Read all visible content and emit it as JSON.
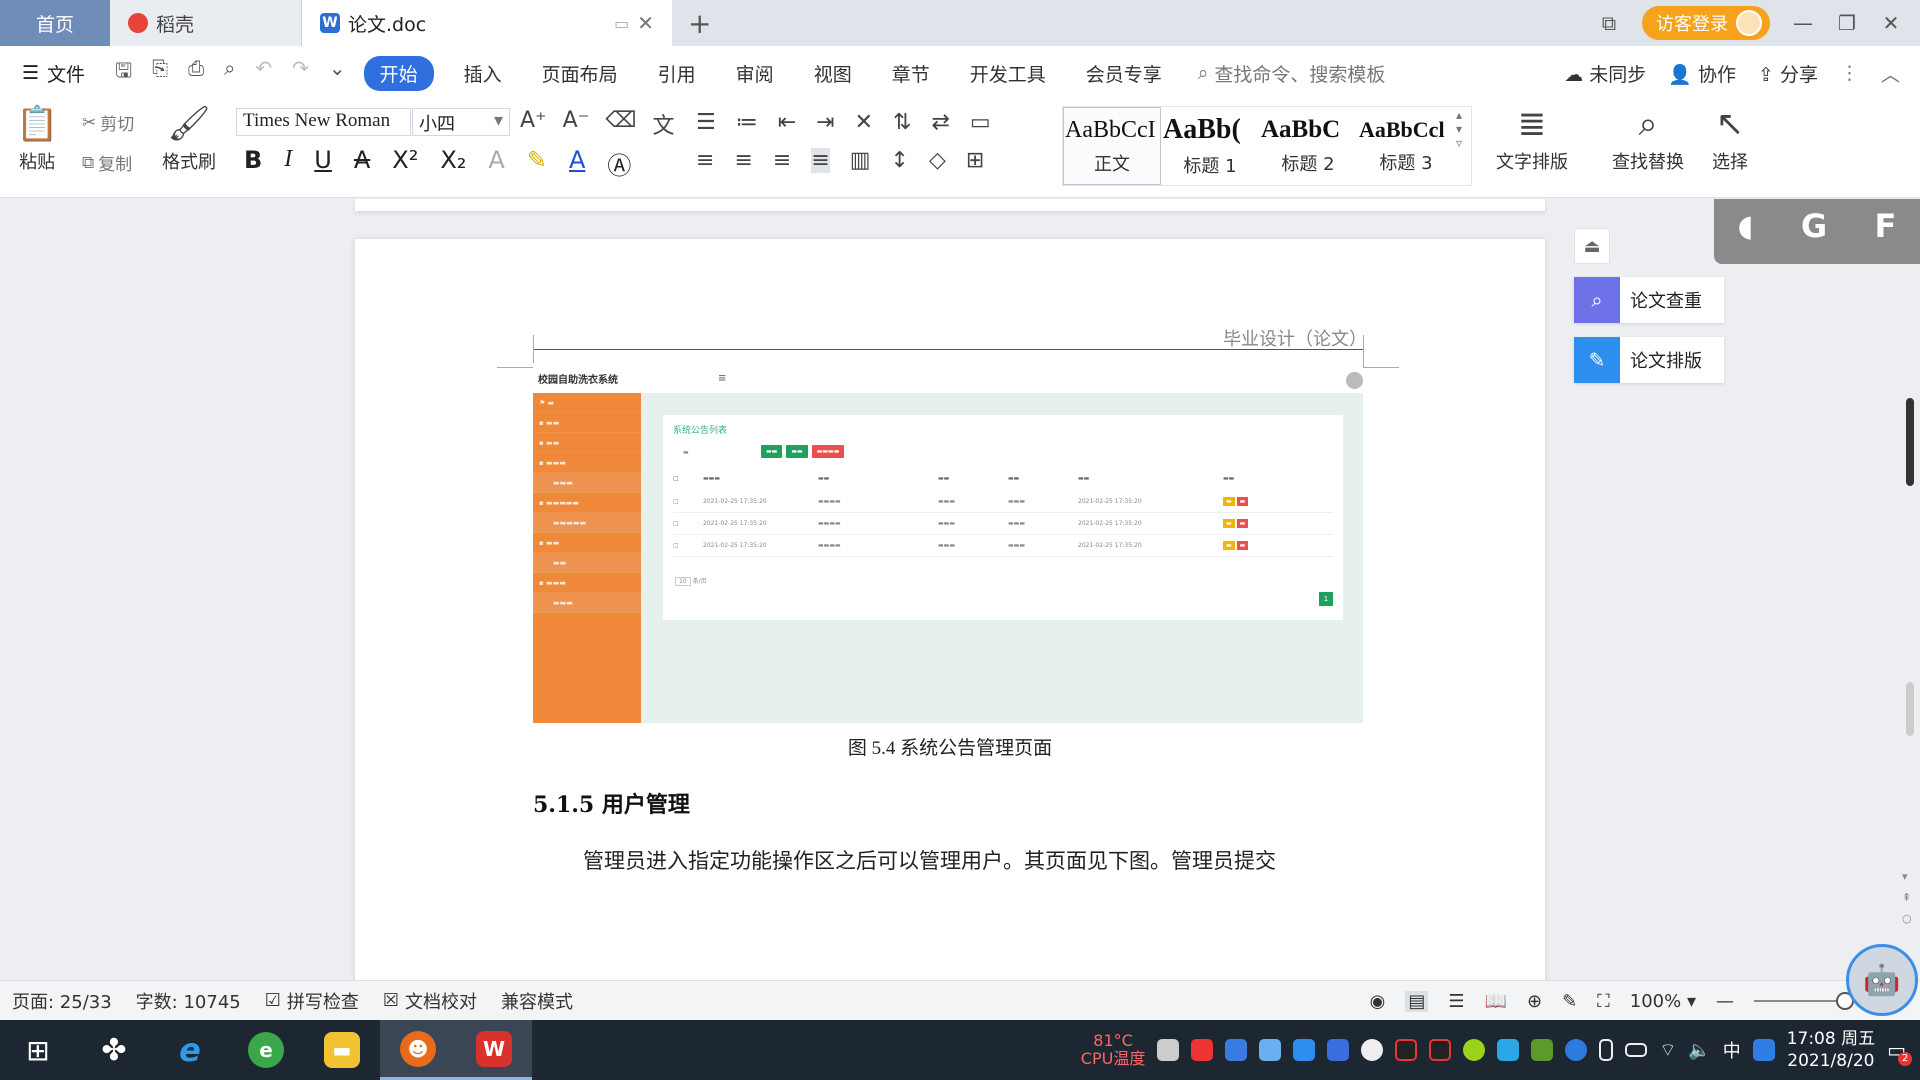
{
  "tabs": {
    "home": "首页",
    "daoke": "稻壳",
    "doc": "论文.doc",
    "visitor_login": "访客登录"
  },
  "menu": {
    "file": "文件",
    "items": [
      "开始",
      "插入",
      "页面布局",
      "引用",
      "审阅",
      "视图",
      "章节",
      "开发工具",
      "会员专享"
    ],
    "search_placeholder": "查找命令、搜索模板",
    "unsynced": "未同步",
    "collab": "协作",
    "share": "分享"
  },
  "ribbon": {
    "paste": "粘贴",
    "cut": "剪切",
    "copy": "复制",
    "format_painter": "格式刷",
    "font_name": "Times New Roman",
    "font_size": "小四",
    "styles": [
      {
        "sample": "AaBbCcI",
        "name": "正文"
      },
      {
        "sample": "AaBb(",
        "name": "标题 1"
      },
      {
        "sample": "AaBbC",
        "name": "标题 2"
      },
      {
        "sample": "AaBbCcl",
        "name": "标题 3"
      }
    ],
    "text_layout": "文字排版",
    "find_replace": "查找替换",
    "select": "选择"
  },
  "document": {
    "header_text": "毕业设计（论文）",
    "figure_caption": "图 5.4  系统公告管理页面",
    "section_heading": "5.1.5  用户管理",
    "body_text": "管理员进入指定功能操作区之后可以管理用户。其页面见下图。管理员提交"
  },
  "embedded_screenshot": {
    "app_title": "校园自助洗衣系统",
    "card_title": "系统公告列表",
    "rows": [
      {
        "time": "2021-02-25 17:35:20",
        "date": "2021-02-25 17:35:20"
      },
      {
        "time": "2021-02-25 17:35:20",
        "date": "2021-02-25 17:35:20"
      },
      {
        "time": "2021-02-25 17:35:20",
        "date": "2021-02-25 17:35:20"
      }
    ],
    "page_num": "1",
    "pager": "10",
    "pager_suffix": "条/页"
  },
  "side_panel": {
    "check": "论文查重",
    "format": "论文排版"
  },
  "ime": {
    "g": "G",
    "f": "F"
  },
  "status": {
    "page": "页面: 25/33",
    "words": "字数: 10745",
    "spell": "拼写检查",
    "proof": "文档校对",
    "compat": "兼容模式",
    "zoom": "100%"
  },
  "taskbar": {
    "temp": "81°C",
    "temp_label": "CPU温度",
    "lang": "中",
    "time": "17:08 周五",
    "date": "2021/8/20",
    "notif_count": "2"
  }
}
